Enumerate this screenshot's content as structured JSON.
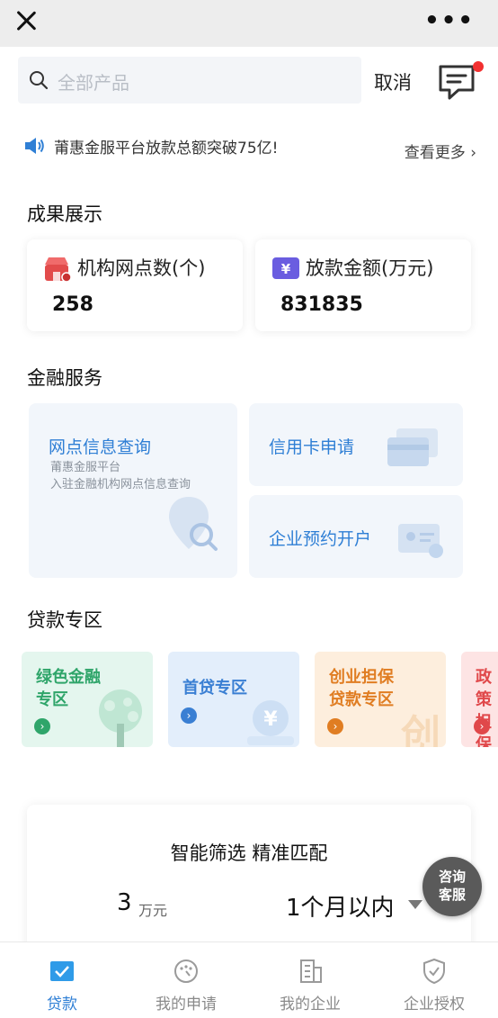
{
  "search": {
    "placeholder": "全部产品",
    "cancel_label": "取消"
  },
  "notice": {
    "text": "莆惠金服平台放款总额突破75亿!",
    "more": "查看更多"
  },
  "achievements": {
    "title": "成果展示",
    "cards": [
      {
        "label": "机构网点数(个)",
        "value": "258",
        "icon": "store-icon"
      },
      {
        "label": "放款金额(万元)",
        "value": "831835",
        "icon": "yen-wallet-icon"
      }
    ]
  },
  "finance": {
    "title": "金融服务",
    "branch_query": {
      "title": "网点信息查询",
      "sub1": "莆惠金服平台",
      "sub2": "入驻金融机构网点信息查询"
    },
    "credit_card": {
      "title": "信用卡申请"
    },
    "enterprise_account": {
      "title": "企业预约开户"
    }
  },
  "loans": {
    "title": "贷款专区",
    "tiles": [
      {
        "line1": "绿色金融",
        "line2": "专区",
        "color": "#2fa56a"
      },
      {
        "line1": "首贷专区",
        "line2": "",
        "color": "#3a7fd3"
      },
      {
        "line1": "创业担保",
        "line2": "贷款专区",
        "color": "#e07d22"
      },
      {
        "line1": "政策",
        "line2": "担保",
        "color": "#e0484a"
      }
    ]
  },
  "smart_match": {
    "heading": "智能筛选 精准匹配",
    "amount": "3",
    "amount_unit": "万元",
    "term": "1个月以内"
  },
  "consult": {
    "line1": "咨询",
    "line2": "客服"
  },
  "tabs": [
    {
      "label": "贷款",
      "icon": "loan-icon",
      "active": true
    },
    {
      "label": "我的申请",
      "icon": "application-icon"
    },
    {
      "label": "我的企业",
      "icon": "building-icon"
    },
    {
      "label": "企业授权",
      "icon": "shield-check-icon"
    }
  ],
  "colors": {
    "accent": "#2f7fd5",
    "badge": "#f23030"
  }
}
